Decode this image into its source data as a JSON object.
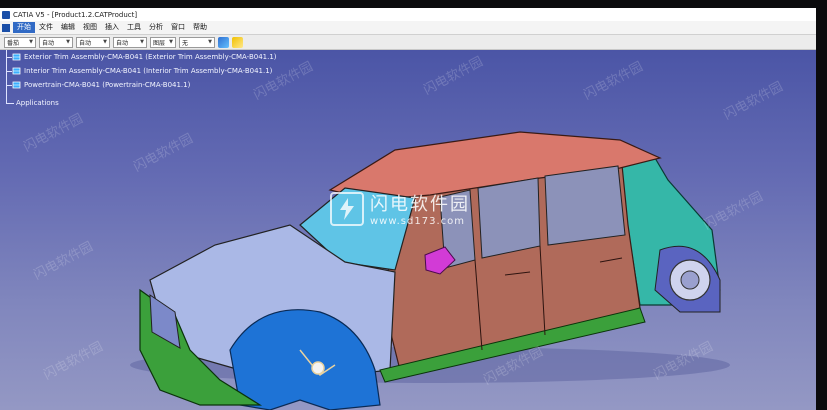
{
  "window": {
    "title": "CATIA V5 - [Product1.2.CATProduct]"
  },
  "menubar": {
    "items": [
      {
        "label": "开始",
        "active": true
      },
      {
        "label": "文件"
      },
      {
        "label": "编辑"
      },
      {
        "label": "视图"
      },
      {
        "label": "插入"
      },
      {
        "label": "工具"
      },
      {
        "label": "分析"
      },
      {
        "label": "窗口"
      },
      {
        "label": "帮助"
      }
    ]
  },
  "toolbar": {
    "combos": [
      {
        "value": "番茄"
      },
      {
        "value": "自动"
      },
      {
        "value": "自动"
      },
      {
        "value": "自动"
      },
      {
        "value": "图层"
      },
      {
        "value": "无"
      }
    ]
  },
  "tree": {
    "items": [
      {
        "label": "Exterior Trim Assembly-CMA-B041 (Exterior Trim Assembly-CMA-B041.1)"
      },
      {
        "label": "Interior Trim Assembly-CMA-B041 (Interior Trim Assembly-CMA-B041.1)"
      },
      {
        "label": "Powertrain-CMA-B041 (Powertrain-CMA-B041.1)"
      },
      {
        "label": "Applications"
      }
    ]
  },
  "watermark": {
    "brand": "闪电软件园",
    "url": "www.sd173.com",
    "repeat_text": "闪电软件园"
  },
  "colors": {
    "viewport_top": "#4b55a6",
    "viewport_bottom": "#9498c4",
    "body_panels": "#b06a5a",
    "roof": "#d9786c",
    "front_panels": "#aab8e6",
    "rear_panels": "#35b7a8",
    "bumpers": "#3ba03b",
    "wheel_arch": "#1e73d6",
    "mirror": "#d23bd6"
  },
  "icons": {
    "app": "catia-icon",
    "node": "product-node-icon"
  }
}
